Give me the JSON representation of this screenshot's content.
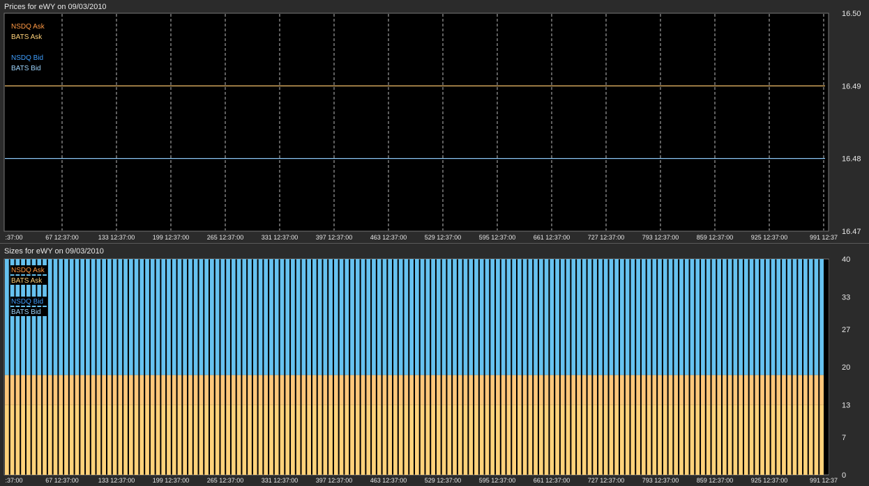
{
  "prices_panel": {
    "title": "Prices for  eWY  on  09/03/2010",
    "legend": [
      {
        "label": "NSDQ Ask",
        "color": "#ff9944"
      },
      {
        "label": "BATS Ask",
        "color": "#ffd27a"
      },
      {
        "label": "NSDQ Bid",
        "color": "#3f9fff"
      },
      {
        "label": "BATS Bid",
        "color": "#9ed6ff"
      }
    ]
  },
  "sizes_panel": {
    "title": "Sizes for  eWY  on  09/03/2010",
    "legend": [
      {
        "label": "NSDQ Ask",
        "color": "#ff9944"
      },
      {
        "label": "BATS Ask",
        "color": "#ffd27a"
      },
      {
        "label": "NSDQ Bid",
        "color": "#3f9fff"
      },
      {
        "label": "BATS Bid",
        "color": "#9ed6ff"
      }
    ]
  },
  "x_tick_labels": [
    ":37:00",
    "67 12:37:00",
    "133 12:37:00",
    "199 12:37:00",
    "265 12:37:00",
    "331 12:37:00",
    "397 12:37:00",
    "463 12:37:00",
    "529 12:37:00",
    "595 12:37:00",
    "661 12:37:00",
    "727 12:37:00",
    "793 12:37:00",
    "859 12:37:00",
    "925 12:37:00",
    "991 12:37"
  ],
  "chart_data": [
    {
      "type": "line",
      "title": "Prices for  eWY  on  09/03/2010",
      "ylim": [
        16.47,
        16.5
      ],
      "y_ticks": [
        "16.50",
        "16.49",
        "16.48",
        "16.47"
      ],
      "x_range": [
        1,
        1015
      ],
      "series": [
        {
          "name": "NSDQ Ask",
          "color": "#ff9944",
          "value": 16.49
        },
        {
          "name": "BATS Ask",
          "color": "#ffd27a",
          "value": 16.49
        },
        {
          "name": "NSDQ Bid",
          "color": "#3f9fff",
          "value": 16.48
        },
        {
          "name": "BATS Bid",
          "color": "#9ed6ff",
          "value": 16.48
        }
      ]
    },
    {
      "type": "bar",
      "title": "Sizes for  eWY  on  09/03/2010",
      "ylim": [
        0,
        40
      ],
      "y_ticks": [
        "40",
        "33",
        "27",
        "20",
        "13",
        "7",
        "0"
      ],
      "bar_count": 152,
      "stacked_levels": [
        {
          "name": "ask-lower",
          "color": "#ffd27a",
          "value": 13
        },
        {
          "name": "ask-upper",
          "color": "#ffc77a",
          "value": 18.5
        },
        {
          "name": "bid",
          "color": "#66c2f0",
          "value": 40
        }
      ]
    }
  ]
}
